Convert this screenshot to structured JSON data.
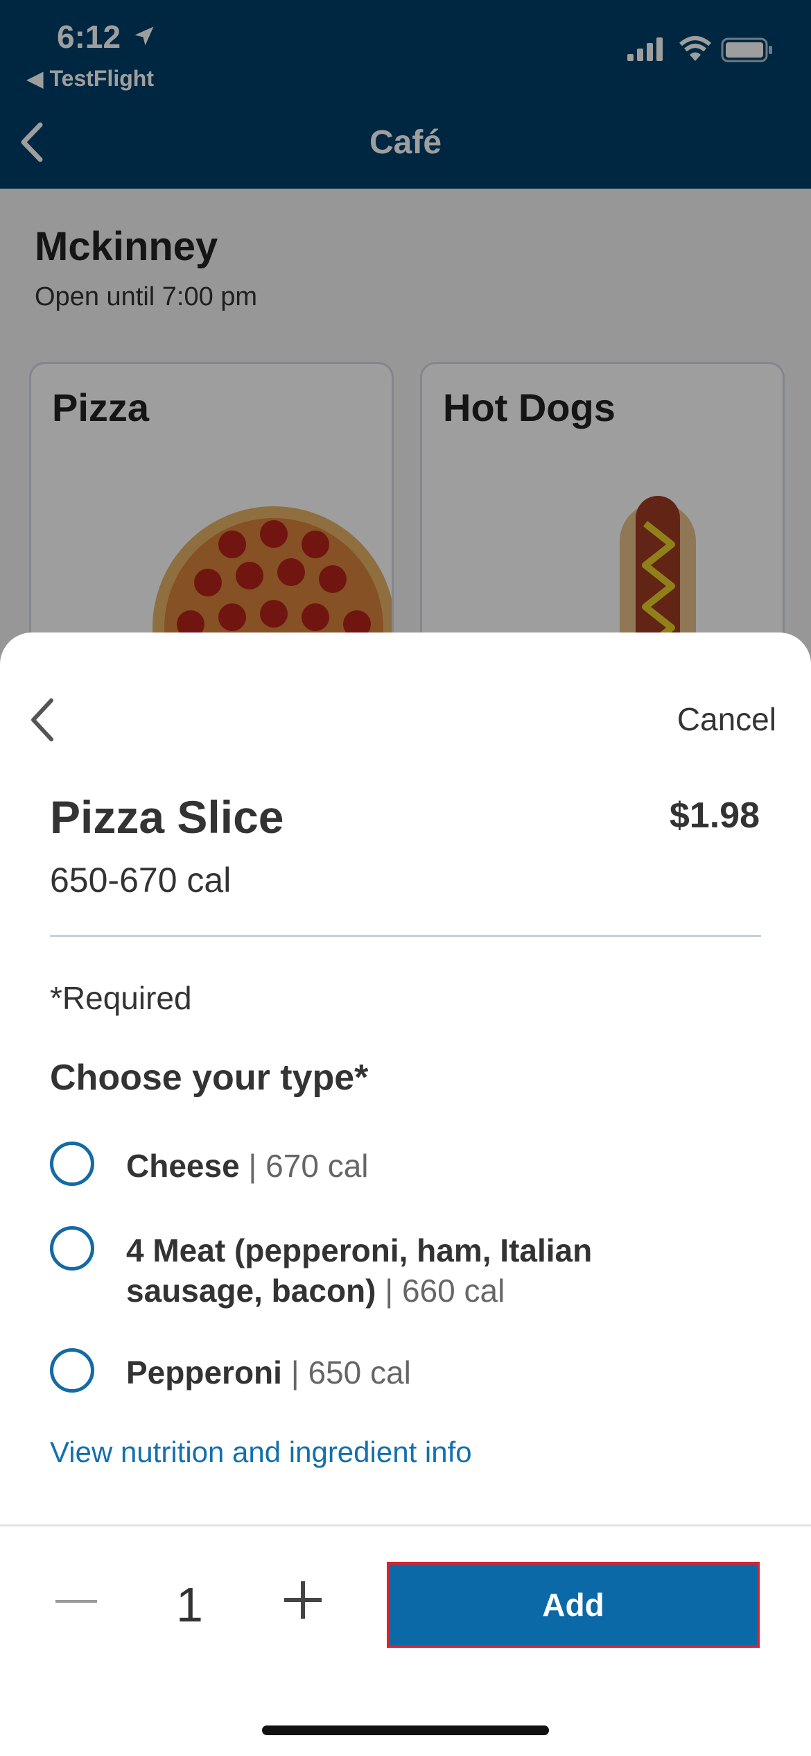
{
  "status_bar": {
    "time": "6:12",
    "back_app": "◀ TestFlight"
  },
  "nav": {
    "title": "Café"
  },
  "location": {
    "name": "Mckinney",
    "hours": "Open until 7:00 pm"
  },
  "categories": [
    {
      "label": "Pizza"
    },
    {
      "label": "Hot Dogs"
    }
  ],
  "sheet": {
    "cancel_label": "Cancel",
    "item_name": "Pizza Slice",
    "item_price": "$1.98",
    "item_calories": "650-670 cal",
    "required_note": "*Required",
    "choose_heading": "Choose your type*",
    "options": [
      {
        "name": "Cheese",
        "sep": " | ",
        "cal": "670 cal"
      },
      {
        "name": "4 Meat  (pepperoni, ham, Italian sausage, bacon)",
        "sep": " | ",
        "cal": "660 cal"
      },
      {
        "name": "Pepperoni",
        "sep": " | ",
        "cal": "650 cal"
      }
    ],
    "nutrition_link": "View nutrition and ingredient info"
  },
  "footer": {
    "quantity": "1",
    "add_label": "Add"
  },
  "colors": {
    "header": "#003f6a",
    "accent": "#0b69a8",
    "radio": "#136aa5",
    "highlight": "#e21f2b"
  }
}
